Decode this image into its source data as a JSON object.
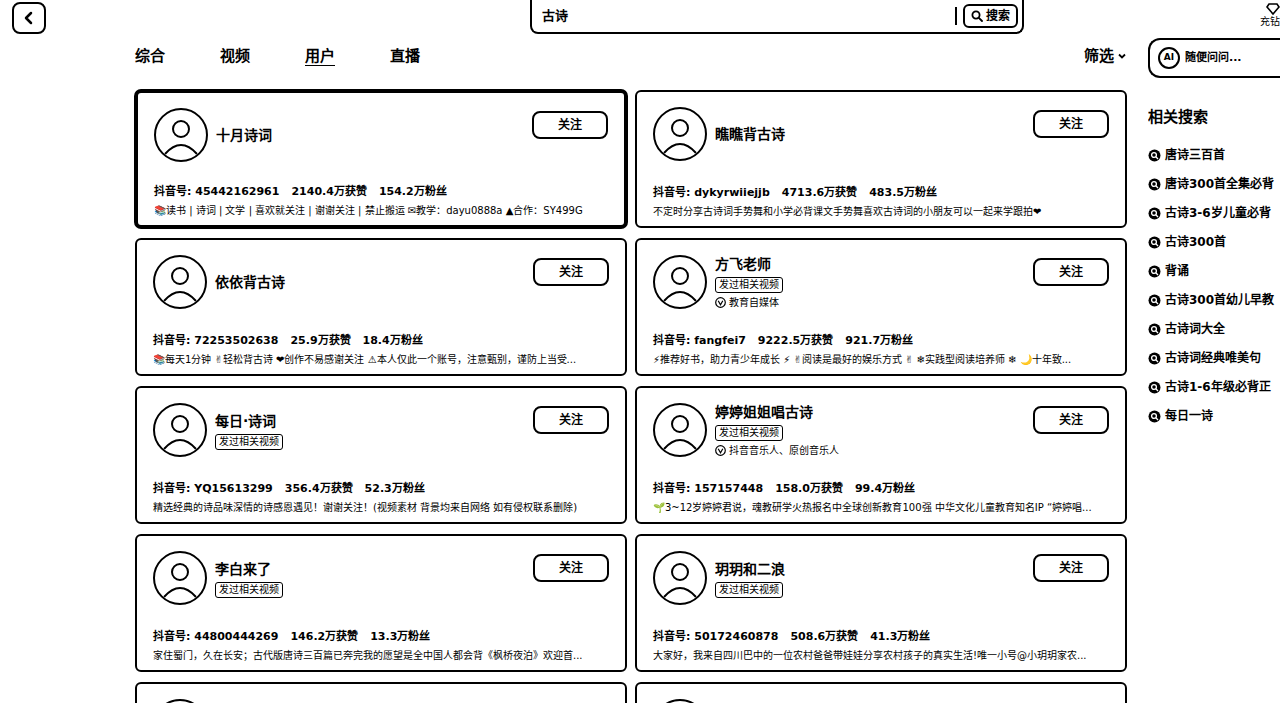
{
  "search": {
    "query": "古诗",
    "button": "搜索"
  },
  "recharge": "充钻",
  "tabs": [
    {
      "label": "综合",
      "selected": false
    },
    {
      "label": "视频",
      "selected": false
    },
    {
      "label": "用户",
      "selected": true
    },
    {
      "label": "直播",
      "selected": false
    }
  ],
  "filter": "筛选",
  "ai": {
    "badge": "AI",
    "placeholder": "随便问问..."
  },
  "related": {
    "title": "相关搜索",
    "items": [
      "唐诗三百首",
      "唐诗300首全集必背",
      "古诗3-6岁儿童必背",
      "古诗300首",
      "背诵",
      "古诗300首幼儿早教",
      "古诗词大全",
      "古诗词经典唯美句",
      "古诗1-6年级必背正",
      "每日一诗"
    ]
  },
  "users": [
    {
      "name": "十月诗词",
      "id": "抖音号: 45442162961",
      "likes": "2140.4万获赞",
      "fans": "154.2万粉丝",
      "desc": "📚读书 | 诗词 | 文学 | 喜欢就关注 | 谢谢关注 | 禁止搬运 ✉教学：dayu0888a ▲合作：SY499G",
      "follow": "关注",
      "hovered": true
    },
    {
      "name": "瞧瞧背古诗",
      "id": "抖音号: dykyrwiiejjb",
      "likes": "4713.6万获赞",
      "fans": "483.5万粉丝",
      "desc": "不定时分享古诗词手势舞和小学必背课文手势舞喜欢古诗词的小朋友可以一起来学跟拍❤",
      "follow": "关注",
      "hovered": false
    },
    {
      "name": "依依背古诗",
      "id": "抖音号: 72253502638",
      "likes": "25.9万获赞",
      "fans": "18.4万粉丝",
      "desc": "📚每天1分钟 ✌轻松背古诗 ❤创作不易感谢关注 ⚠本人仅此一个账号，注意甄别，谨防上当受...",
      "follow": "关注",
      "hovered": false
    },
    {
      "name": "方飞老师",
      "badge": "发过相关视频",
      "verify": "教育自媒体",
      "id": "抖音号: fangfei7",
      "likes": "9222.5万获赞",
      "fans": "921.7万粉丝",
      "desc": "⚡推荐好书，助力青少年成长 ⚡ ✌阅读是最好的娱乐方式 ✌ ❄实践型阅读培养师 ❄ 🌙十年致...",
      "follow": "关注",
      "hovered": false
    },
    {
      "name": "每日·诗词",
      "badge": "发过相关视频",
      "id": "抖音号: YQ15613299",
      "likes": "356.4万获赞",
      "fans": "52.3万粉丝",
      "desc": "精选经典的诗品味深情的诗感恩遇见！谢谢关注！(视频素材 背景均来自网络 如有侵权联系删除)",
      "follow": "关注",
      "hovered": false
    },
    {
      "name": "婷婷姐姐唱古诗",
      "badge": "发过相关视频",
      "verify": "抖音音乐人、原创音乐人",
      "id": "抖音号: 157157448",
      "likes": "158.0万获赞",
      "fans": "99.4万粉丝",
      "desc": "🌱3~12岁婷婷君说，魂教研学火热报名中全球创新教育100强 中华文化儿童教育知名IP “婷婷唱...",
      "follow": "关注",
      "hovered": false
    },
    {
      "name": "李白来了",
      "badge": "发过相关视频",
      "id": "抖音号: 44800444269",
      "likes": "146.2万获赞",
      "fans": "13.3万粉丝",
      "desc": "家住蜀门，久在长安；古代版唐诗三百篇已奔完我的愿望是全中国人都会背《枫桥夜泊》欢迎首...",
      "follow": "关注",
      "hovered": false
    },
    {
      "name": "玥玥和二浪",
      "badge": "发过相关视频",
      "id": "抖音号: 50172460878",
      "likes": "508.6万获赞",
      "fans": "41.3万粉丝",
      "desc": "大家好，我来自四川巴中的一位农村爸爸带娃娃分享农村孩子的真实生活!唯一小号@小玥玥家农...",
      "follow": "关注",
      "hovered": false
    }
  ]
}
